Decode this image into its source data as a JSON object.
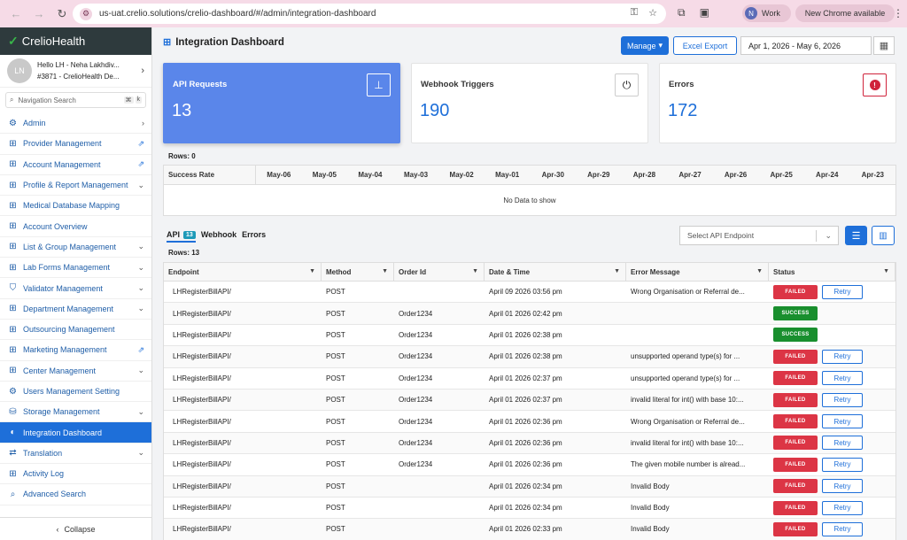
{
  "browser": {
    "url": "us-uat.crelio.solutions/crelio-dashboard/#/admin/integration-dashboard",
    "profile_initial": "N",
    "profile_label": "Work",
    "update_label": "New Chrome available"
  },
  "sidebar": {
    "brand": "CrelioHealth",
    "user_initials": "LN",
    "user_line1": "Hello LH - Neha Lakhdiv...",
    "user_line2": "#3871 - CrelioHealth De...",
    "search_placeholder": "Navigation Search",
    "search_key1": "⌘",
    "search_key2": "k",
    "items": [
      {
        "label": "Admin",
        "icon": "gear-icon",
        "tail": "›"
      },
      {
        "label": "Provider Management",
        "icon": "grid-icon",
        "tail": "external-link-icon"
      },
      {
        "label": "Account Management",
        "icon": "grid-icon",
        "tail": "external-link-icon"
      },
      {
        "label": "Profile & Report Management",
        "icon": "grid-icon",
        "tail": "chevron-down-icon"
      },
      {
        "label": "Medical Database Mapping",
        "icon": "grid-icon",
        "tail": ""
      },
      {
        "label": "Account Overview",
        "icon": "grid-icon",
        "tail": ""
      },
      {
        "label": "List & Group Management",
        "icon": "grid-icon",
        "tail": "chevron-down-icon"
      },
      {
        "label": "Lab Forms Management",
        "icon": "grid-icon",
        "tail": "chevron-down-icon"
      },
      {
        "label": "Validator Management",
        "icon": "shield-icon",
        "tail": "chevron-down-icon"
      },
      {
        "label": "Department Management",
        "icon": "grid-icon",
        "tail": "chevron-down-icon"
      },
      {
        "label": "Outsourcing Management",
        "icon": "grid-icon",
        "tail": ""
      },
      {
        "label": "Marketing Management",
        "icon": "grid-icon",
        "tail": "external-link-icon"
      },
      {
        "label": "Center Management",
        "icon": "grid-icon",
        "tail": "chevron-down-icon"
      },
      {
        "label": "Users Management Setting",
        "icon": "gear-icon",
        "tail": ""
      },
      {
        "label": "Storage Management",
        "icon": "storage-icon",
        "tail": "chevron-down-icon"
      },
      {
        "label": "Integration Dashboard",
        "icon": "dashboard-icon",
        "tail": "",
        "active": true
      },
      {
        "label": "Translation",
        "icon": "translate-icon",
        "tail": "chevron-down-icon"
      },
      {
        "label": "Activity Log",
        "icon": "grid-icon",
        "tail": ""
      },
      {
        "label": "Advanced Search",
        "icon": "search-icon",
        "tail": ""
      }
    ],
    "collapse_label": "Collapse"
  },
  "header": {
    "title": "Integration Dashboard",
    "manage_label": "Manage",
    "export_label": "Excel Export",
    "date_range": "Apr 1, 2026 - May 6, 2026"
  },
  "cards": [
    {
      "label": "API Requests",
      "value": "13",
      "icon": "sitemap-icon"
    },
    {
      "label": "Webhook Triggers",
      "value": "190",
      "icon": "plug-icon"
    },
    {
      "label": "Errors",
      "value": "172",
      "icon": "alert-icon"
    }
  ],
  "success_table": {
    "rows_label": "Rows: 0",
    "first_col": "Success Rate",
    "dates": [
      "May-06",
      "May-05",
      "May-04",
      "May-03",
      "May-02",
      "May-01",
      "Apr-30",
      "Apr-29",
      "Apr-28",
      "Apr-27",
      "Apr-26",
      "Apr-25",
      "Apr-24",
      "Apr-23"
    ],
    "empty_text": "No Data to show"
  },
  "tabs": {
    "api_label": "API",
    "api_count": "13",
    "webhook_label": "Webhook",
    "errors_label": "Errors",
    "endpoint_placeholder": "Select API Endpoint"
  },
  "grid": {
    "rows_label": "Rows: 13",
    "columns": [
      "Endpoint",
      "Method",
      "Order Id",
      "Date & Time",
      "Error Message",
      "Status"
    ],
    "retry_label": "Retry",
    "rows": [
      {
        "endpoint": "LHRegisterBillAPI/",
        "method": "POST",
        "order": "",
        "date": "April 09 2026 03:56 pm",
        "error": "Wrong Organisation or Referral de...",
        "status": "FAILED"
      },
      {
        "endpoint": "LHRegisterBillAPI/",
        "method": "POST",
        "order": "Order1234",
        "date": "April 01 2026 02:42 pm",
        "error": "",
        "status": "SUCCESS"
      },
      {
        "endpoint": "LHRegisterBillAPI/",
        "method": "POST",
        "order": "Order1234",
        "date": "April 01 2026 02:38 pm",
        "error": "",
        "status": "SUCCESS"
      },
      {
        "endpoint": "LHRegisterBillAPI/",
        "method": "POST",
        "order": "Order1234",
        "date": "April 01 2026 02:38 pm",
        "error": "unsupported operand type(s) for ...",
        "status": "FAILED"
      },
      {
        "endpoint": "LHRegisterBillAPI/",
        "method": "POST",
        "order": "Order1234",
        "date": "April 01 2026 02:37 pm",
        "error": "unsupported operand type(s) for ...",
        "status": "FAILED"
      },
      {
        "endpoint": "LHRegisterBillAPI/",
        "method": "POST",
        "order": "Order1234",
        "date": "April 01 2026 02:37 pm",
        "error": "invalid literal for int() with base 10:...",
        "status": "FAILED"
      },
      {
        "endpoint": "LHRegisterBillAPI/",
        "method": "POST",
        "order": "Order1234",
        "date": "April 01 2026 02:36 pm",
        "error": "Wrong Organisation or Referral de...",
        "status": "FAILED"
      },
      {
        "endpoint": "LHRegisterBillAPI/",
        "method": "POST",
        "order": "Order1234",
        "date": "April 01 2026 02:36 pm",
        "error": "invalid literal for int() with base 10:...",
        "status": "FAILED"
      },
      {
        "endpoint": "LHRegisterBillAPI/",
        "method": "POST",
        "order": "Order1234",
        "date": "April 01 2026 02:36 pm",
        "error": "The given mobile number is alread...",
        "status": "FAILED"
      },
      {
        "endpoint": "LHRegisterBillAPI/",
        "method": "POST",
        "order": "",
        "date": "April 01 2026 02:34 pm",
        "error": "Invalid Body",
        "status": "FAILED"
      },
      {
        "endpoint": "LHRegisterBillAPI/",
        "method": "POST",
        "order": "",
        "date": "April 01 2026 02:34 pm",
        "error": "Invalid Body",
        "status": "FAILED"
      },
      {
        "endpoint": "LHRegisterBillAPI/",
        "method": "POST",
        "order": "",
        "date": "April 01 2026 02:33 pm",
        "error": "Invalid Body",
        "status": "FAILED"
      }
    ]
  },
  "colors": {
    "accent": "#1e6fd9",
    "card_active": "#5a86ea",
    "failed": "#dc3545",
    "success": "#198f2e",
    "logo_green": "#39b54a"
  }
}
